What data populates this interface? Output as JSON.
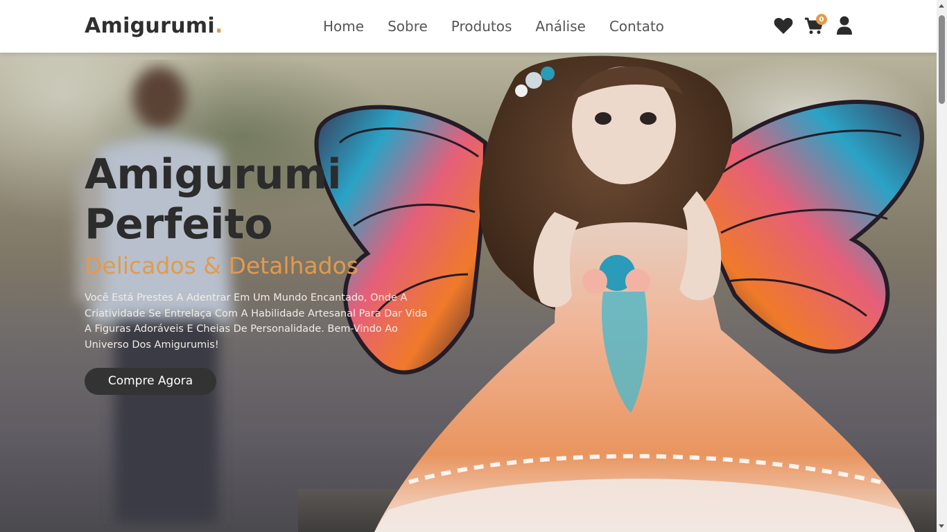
{
  "brand": {
    "name": "Amigurumi",
    "dot": ".",
    "accent_color": "#e39a4b"
  },
  "nav": {
    "items": [
      {
        "label": "Home"
      },
      {
        "label": "Sobre"
      },
      {
        "label": "Produtos"
      },
      {
        "label": "Análise"
      },
      {
        "label": "Contato"
      }
    ]
  },
  "header_icons": {
    "favorites": "heart-icon",
    "cart": "cart-icon",
    "cart_count": "0",
    "account": "user-icon"
  },
  "hero": {
    "title": "Amigurumi Perfeito",
    "subtitle": "Delicados & Detalhados",
    "description": "Você Está Prestes A Adentrar Em Um Mundo Encantado, Onde A Criatividade Se Entrelaça Com A Habilidade Artesanal Para Dar Vida A Figuras Adoráveis E Cheias De Personalidade. Bem-Vindo Ao Universo Dos Amigurumis!",
    "cta_label": "Compre Agora",
    "cta_color": "#333333"
  }
}
